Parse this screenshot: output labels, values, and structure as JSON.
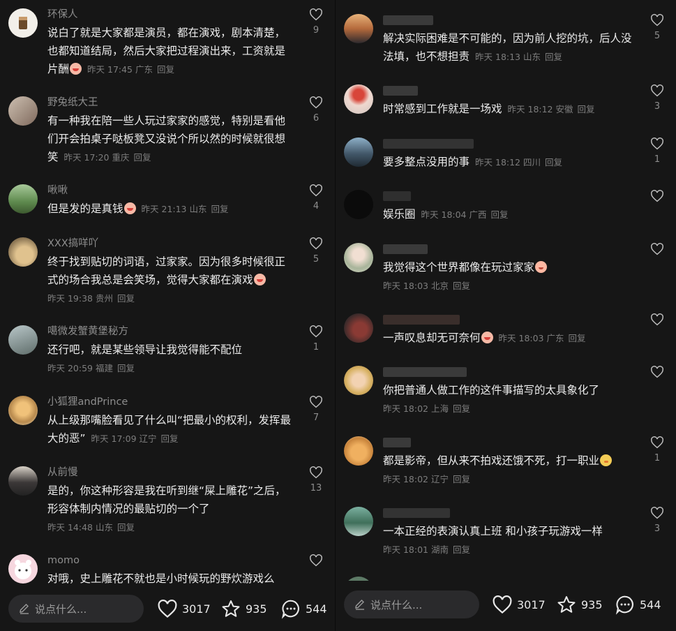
{
  "left": {
    "comments": [
      {
        "name": "环保人",
        "text": "说白了就是大家都是演员，都在演戏，剧本清楚，也都知道结局，然后大家把过程演出来，工资就是片酬",
        "emoji": "cry",
        "time": "昨天 17:45",
        "loc": "广东",
        "reply": "回复",
        "likes": "9"
      },
      {
        "name": "野兔纸大王",
        "text": "有一种我在陪一些人玩过家家的感觉，特别是看他们开会拍桌子哒板凳又没说个所以然的时候就很想笑",
        "time": "昨天 17:20",
        "loc": "重庆",
        "reply": "回复",
        "likes": "6"
      },
      {
        "name": "啾啾",
        "text": "但是发的是真钱",
        "emoji": "cry",
        "time": "昨天 21:13",
        "loc": "山东",
        "reply": "回复",
        "likes": "4"
      },
      {
        "name": "XXX搞咩吖",
        "text": "终于找到贴切的词语，过家家。因为很多时候很正式的场合我总是会笑场，觉得大家都在演戏",
        "emoji": "cry",
        "time": "昨天 19:38",
        "loc": "贵州",
        "reply": "回复",
        "likes": "5"
      },
      {
        "name": "噶微发蟹黄堡秘方",
        "text": "还行吧，就是某些领导让我觉得能不配位",
        "time": "昨天 20:59",
        "loc": "福建",
        "reply": "回复",
        "likes": "1"
      },
      {
        "name": "小狐狸andPrince",
        "text": "从上级那嘴脸看见了什么叫“把最小的权利，发挥最大的恶”",
        "time": "昨天 17:09",
        "loc": "辽宁",
        "reply": "回复",
        "likes": "7"
      },
      {
        "name": "从前慢",
        "text": "是的，你这种形容是我在听到继“屎上雕花”之后，形容体制内情况的最贴切的一个了",
        "time": "昨天 14:48",
        "loc": "山东",
        "reply": "回复",
        "likes": "13"
      },
      {
        "name": "momo",
        "text": "对哦，史上雕花不就也是小时候玩的野炊游戏么",
        "time": "",
        "loc": "",
        "reply": "",
        "likes": ""
      }
    ],
    "input_placeholder": "说点什么...",
    "stats": {
      "likes": "3017",
      "stars": "935",
      "comments": "544"
    }
  },
  "right": {
    "comments": [
      {
        "text": "解决实际困难是不可能的，因为前人挖的坑，后人没法填，也不想担责",
        "time": "昨天 18:13",
        "loc": "山东",
        "reply": "回复",
        "likes": "5"
      },
      {
        "text": "时常感到工作就是一场戏",
        "time": "昨天 18:12",
        "loc": "安徽",
        "reply": "回复",
        "likes": "3"
      },
      {
        "text": "要多整点没用的事",
        "time": "昨天 18:12",
        "loc": "四川",
        "reply": "回复",
        "likes": "1"
      },
      {
        "text": "娱乐圈",
        "time": "昨天 18:04",
        "loc": "广西",
        "reply": "回复",
        "likes": ""
      },
      {
        "text": "我觉得这个世界都像在玩过家家",
        "emoji": "face",
        "time": "昨天 18:03",
        "loc": "北京",
        "reply": "回复",
        "likes": ""
      },
      {
        "text": "一声叹息却无可奈何",
        "emoji": "cry",
        "time": "昨天 18:03",
        "loc": "广东",
        "reply": "回复",
        "likes": ""
      },
      {
        "text": "你把普通人做工作的这件事描写的太具象化了",
        "time": "昨天 18:02",
        "loc": "上海",
        "reply": "回复",
        "likes": ""
      },
      {
        "text": "都是影帝，但从来不拍戏还饿不死，打一职业",
        "emoji": "chick",
        "time": "昨天 18:02",
        "loc": "辽宁",
        "reply": "回复",
        "likes": "1"
      },
      {
        "text": "一本正经的表演认真上班 和小孩子玩游戏一样",
        "time": "昨天 18:01",
        "loc": "湖南",
        "reply": "回复",
        "likes": "3"
      }
    ],
    "input_placeholder": "说点什么...",
    "stats": {
      "likes": "3017",
      "stars": "935",
      "comments": "544"
    }
  },
  "colors": {
    "background": "#161616",
    "text": "#ececec",
    "meta": "#7d7d7d",
    "input": "#2a2a2c"
  }
}
